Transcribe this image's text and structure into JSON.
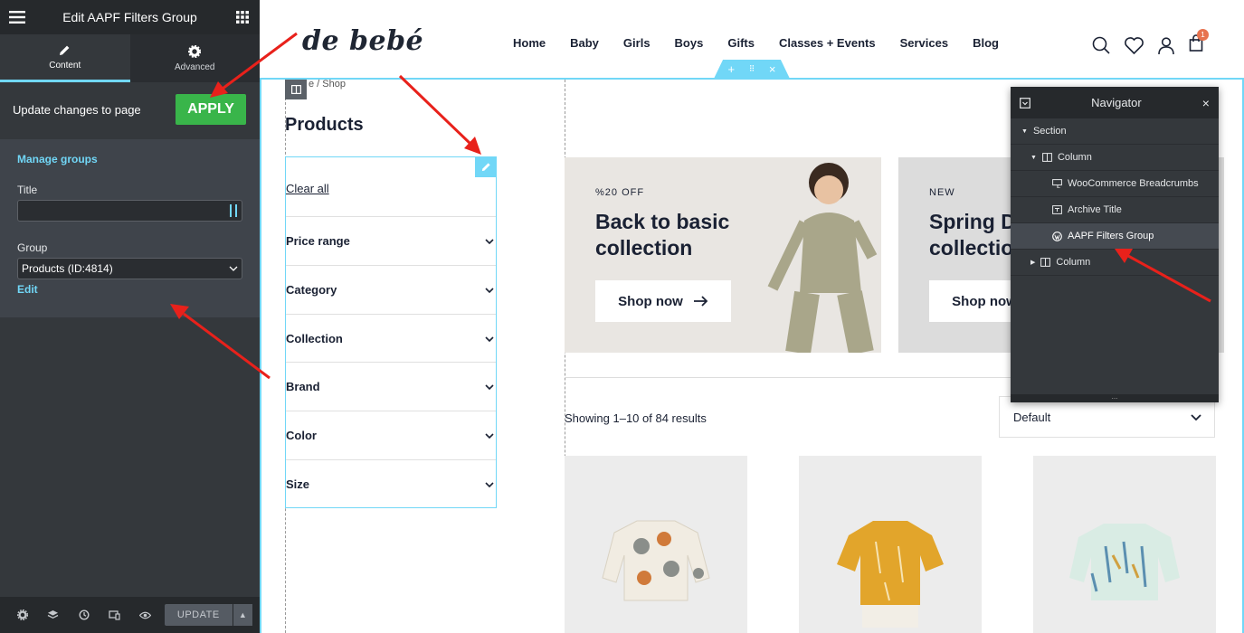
{
  "editor": {
    "title": "Edit AAPF Filters Group",
    "tabs": [
      {
        "label": "Content"
      },
      {
        "label": "Advanced"
      }
    ],
    "update_text": "Update changes to page",
    "apply_label": "APPLY",
    "manage_groups": "Manage groups",
    "title_label": "Title",
    "title_value": "",
    "group_label": "Group",
    "group_value": "Products (ID:4814)",
    "edit_label": "Edit",
    "update_label": "UPDATE"
  },
  "site": {
    "logo": "de bebé",
    "nav": [
      "Home",
      "Baby",
      "Girls",
      "Boys",
      "Gifts",
      "Classes + Events",
      "Services",
      "Blog"
    ],
    "cart_count": "1",
    "breadcrumb": "e / Shop",
    "page_title": "Products",
    "clear_all": "Clear all",
    "filters": [
      "Price range",
      "Category",
      "Collection",
      "Brand",
      "Color",
      "Size"
    ],
    "banners": [
      {
        "kicker": "%20 OFF",
        "title_line1": "Back to basic",
        "title_line2": "collection",
        "button": "Shop now"
      },
      {
        "kicker": "NEW",
        "title_line1": "Spring Dr",
        "title_line2": "collection",
        "button": "Shop now"
      }
    ],
    "showing": "Showing 1–10 of 84 results",
    "sort_value": "Default"
  },
  "navigator": {
    "title": "Navigator",
    "items": [
      {
        "label": "Section"
      },
      {
        "label": "Column"
      },
      {
        "label": "WooCommerce Breadcrumbs"
      },
      {
        "label": "Archive Title"
      },
      {
        "label": "AAPF Filters Group"
      },
      {
        "label": "Column"
      }
    ],
    "footer": "..."
  },
  "colors": {
    "accent": "#71d7f7",
    "apply": "#39b54a",
    "panel": "#34383c",
    "arrow": "#e8211b"
  }
}
